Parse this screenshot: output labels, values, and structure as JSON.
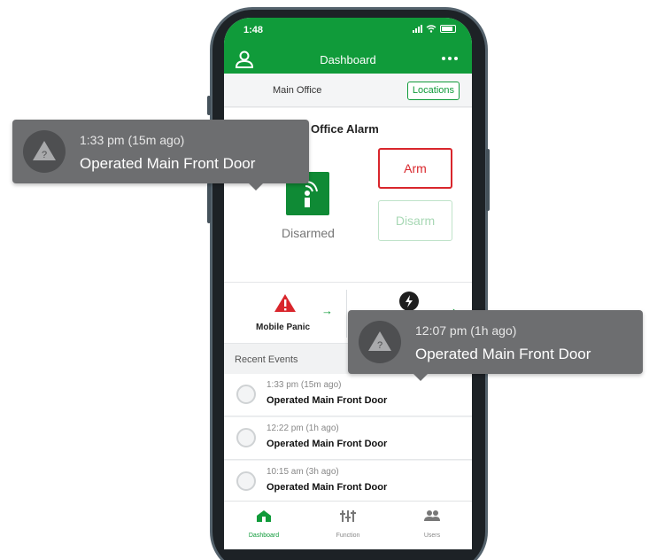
{
  "status_bar": {
    "time": "1:48"
  },
  "header": {
    "title": "Dashboard"
  },
  "location": {
    "name": "Main Office",
    "button_label": "Locations"
  },
  "alarm": {
    "title": "Office Alarm",
    "status": "Disarmed",
    "arm_label": "Arm",
    "disarm_label": "Disarm"
  },
  "quick_actions": {
    "panic_label": "Mobile Panic"
  },
  "events": {
    "section_label": "Recent Events",
    "items": [
      {
        "time": "1:33 pm  (15m ago)",
        "text": "Operated Main Front Door"
      },
      {
        "time": "12:22 pm  (1h ago)",
        "text": "Operated Main Front Door"
      },
      {
        "time": "10:15 am  (3h ago)",
        "text": "Operated Main Front Door"
      }
    ]
  },
  "bottom_nav": [
    {
      "label": "Dashboard",
      "icon": "dashboard-icon",
      "active": true
    },
    {
      "label": "Function",
      "icon": "function-icon",
      "active": false
    },
    {
      "label": "Users",
      "icon": "users-icon",
      "active": false
    }
  ],
  "tooltips": [
    {
      "time": "1:33 pm (15m ago)",
      "text": "Operated Main Front Door"
    },
    {
      "time": "12:07 pm (1h ago)",
      "text": "Operated Main Front Door"
    }
  ],
  "colors": {
    "brand_green": "#109b3a",
    "arm_red": "#d9262c",
    "tooltip_gray": "#6d6e70"
  }
}
